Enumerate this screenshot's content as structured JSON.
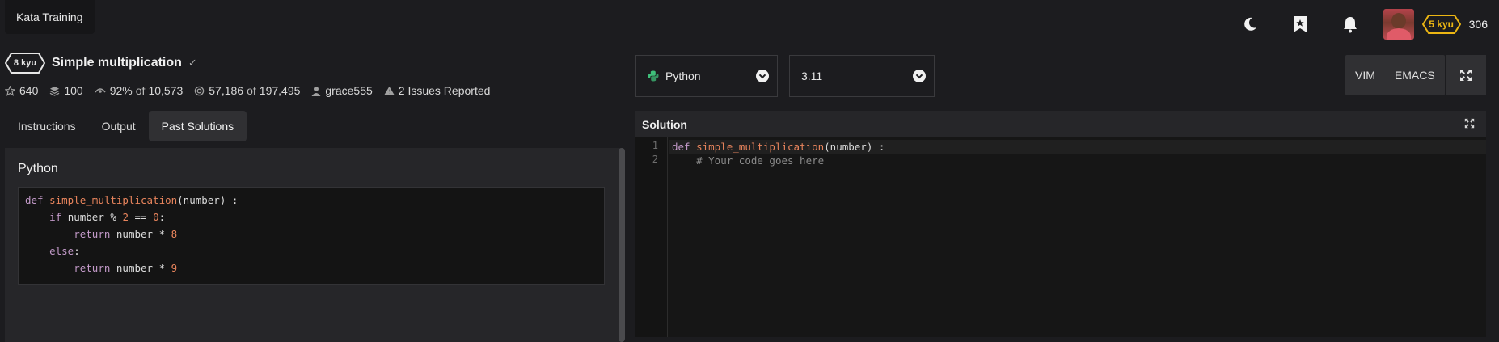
{
  "header": {
    "kata_training_label": "Kata Training",
    "rank": "5 kyu",
    "honor": "306",
    "icons": [
      "moon-icon",
      "bookmark-star-icon",
      "bell-icon",
      "avatar"
    ],
    "rank_color": "#ecb613"
  },
  "kata": {
    "kyu": "8 kyu",
    "title": "Simple multiplication",
    "stats": {
      "stars": "640",
      "collections": "100",
      "satisfaction_pct": "92%",
      "of_label": "of",
      "votes": "10,573",
      "completed": "57,186",
      "attempted": "197,495",
      "author": "grace555",
      "issues": "2 Issues Reported"
    }
  },
  "tabs": [
    {
      "label": "Instructions",
      "active": false
    },
    {
      "label": "Output",
      "active": false
    },
    {
      "label": "Past Solutions",
      "active": true
    }
  ],
  "past_solution": {
    "language": "Python",
    "code_lines": [
      "def simple_multiplication(number) :",
      "    if number % 2 == 0:",
      "        return number * 8",
      "    else:",
      "        return number * 9"
    ]
  },
  "editor": {
    "language": "Python",
    "version": "3.11",
    "keybindings": [
      "VIM",
      "EMACS"
    ],
    "panel_title": "Solution",
    "line_numbers": [
      "1",
      "2"
    ],
    "code_lines": [
      "def simple_multiplication(number) :",
      "    # Your code goes here"
    ]
  }
}
